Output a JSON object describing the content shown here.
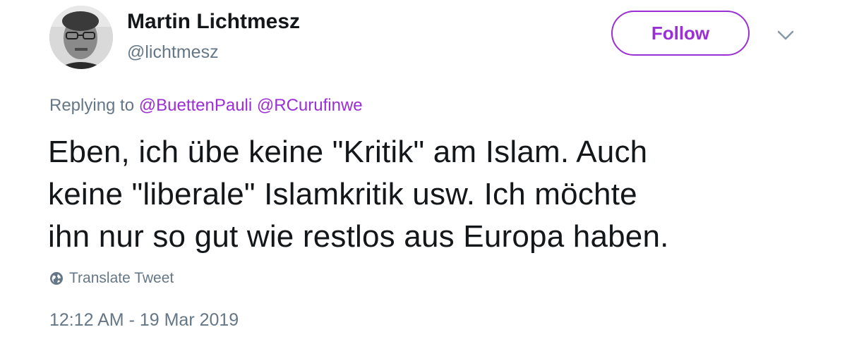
{
  "author": {
    "display_name": "Martin Lichtmesz",
    "handle": "@lichtmesz",
    "avatar_icon": "profile-photo"
  },
  "actions": {
    "follow_label": "Follow",
    "menu_icon": "chevron-down-icon"
  },
  "reply": {
    "prefix": "Replying to",
    "mentions": [
      "@BuettenPauli",
      "@RCurufinwe"
    ]
  },
  "tweet": {
    "lines": [
      "Eben, ich übe keine \"Kritik\" am Islam. Auch",
      "keine \"liberale\" Islamkritik usw. Ich möchte",
      "ihn nur so gut wie restlos aus Europa haben."
    ],
    "translate_label": "Translate Tweet",
    "timestamp": "12:12 AM - 19 Mar 2019"
  },
  "colors": {
    "accent": "#9b2fd6",
    "secondary_text": "#657786",
    "primary_text": "#14171a"
  }
}
